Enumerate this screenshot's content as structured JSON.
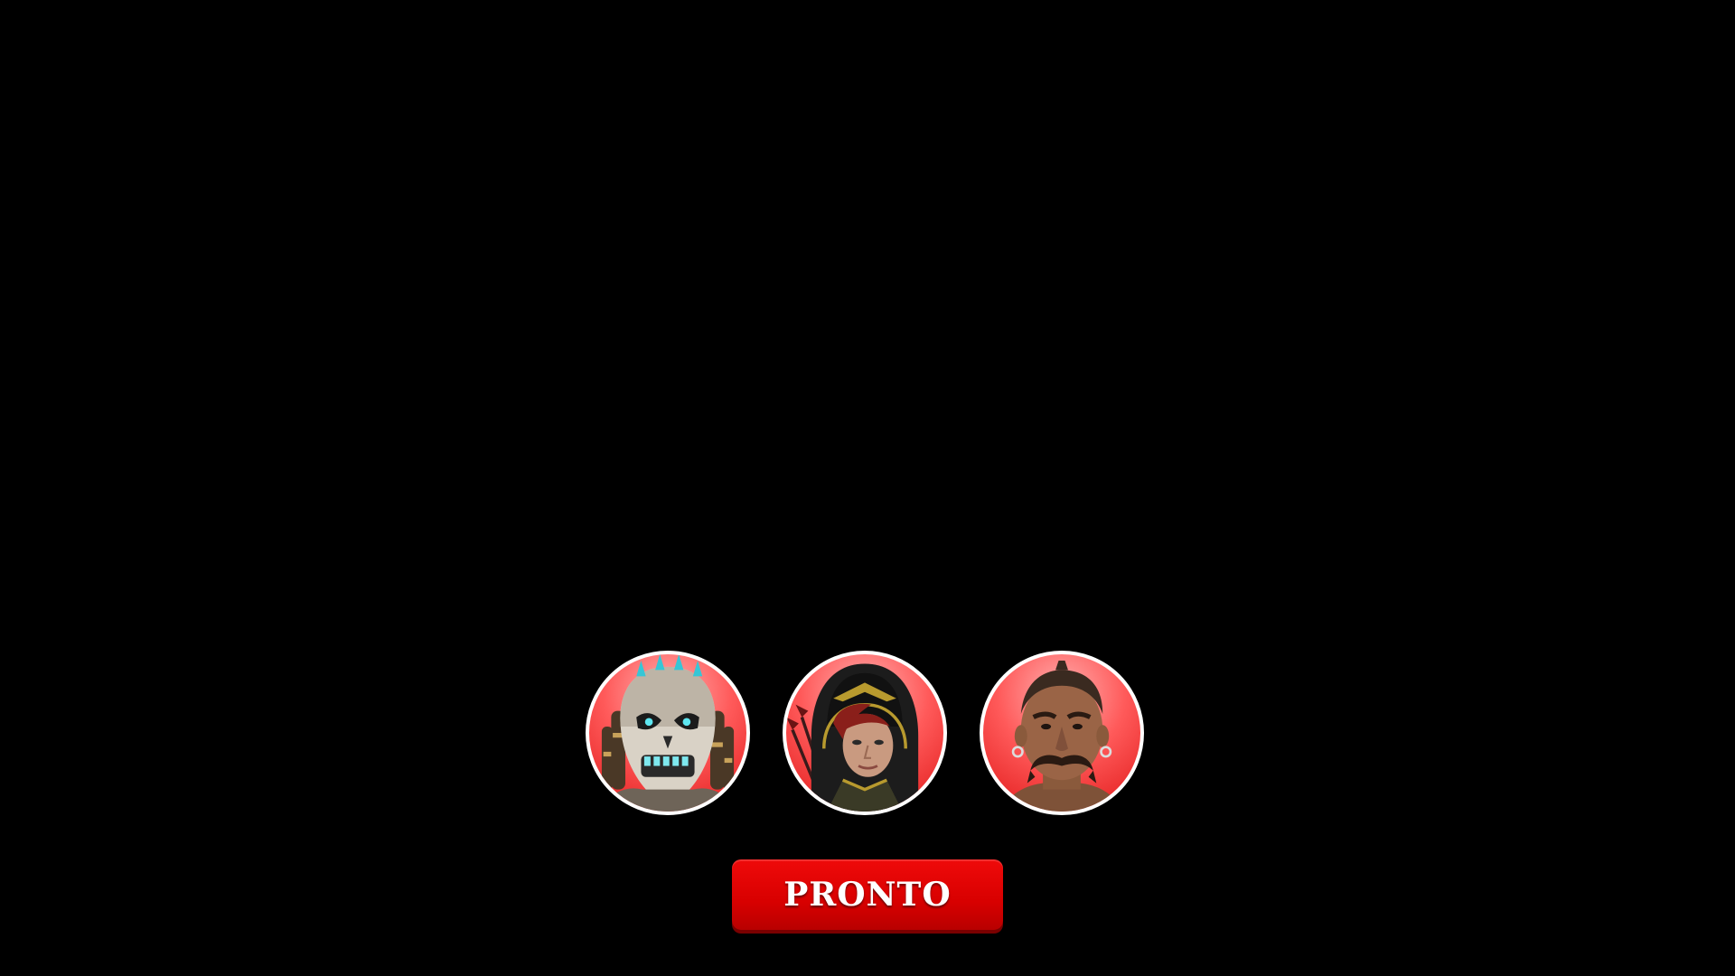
{
  "screen": {
    "background": "#000000"
  },
  "characters": [
    {
      "icon": "armored-skull-warrior-portrait-icon",
      "accent": "#36c6d6"
    },
    {
      "icon": "hooded-archer-portrait-icon",
      "accent": "#b89a2e"
    },
    {
      "icon": "mustached-brawler-portrait-icon",
      "accent": "#8a5a3c"
    }
  ],
  "ready_button": {
    "label": "PRONTO",
    "color": "#d80000"
  }
}
